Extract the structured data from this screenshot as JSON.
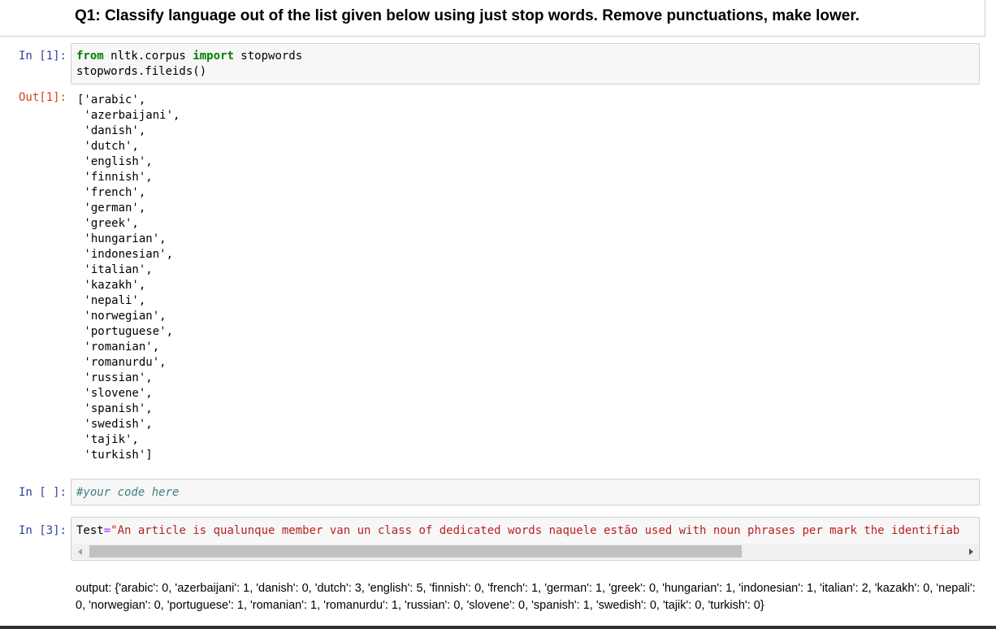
{
  "markdown": {
    "title": "Q1: Classify language out of the list given below using just stop words. Remove punctuations, make lower."
  },
  "cell1": {
    "in_prompt": "In [1]:",
    "line1": {
      "kw1": "from",
      "t1": " nltk.corpus ",
      "kw2": "import",
      "t2": " stopwords"
    },
    "line2": "stopwords.fileids()",
    "out_prompt": "Out[1]:",
    "output_items": [
      "arabic",
      "azerbaijani",
      "danish",
      "dutch",
      "english",
      "finnish",
      "french",
      "german",
      "greek",
      "hungarian",
      "indonesian",
      "italian",
      "kazakh",
      "nepali",
      "norwegian",
      "portuguese",
      "romanian",
      "romanurdu",
      "russian",
      "slovene",
      "spanish",
      "swedish",
      "tajik",
      "turkish"
    ]
  },
  "cell2": {
    "in_prompt": "In [ ]:",
    "code": "#your code here"
  },
  "cell3": {
    "in_prompt": "In [3]:",
    "var": "Test",
    "op": "=",
    "string": "\"An article is qualunque member van un class of dedicated words naquele estão used with noun phrases per mark the identifiab",
    "output": "output: {'arabic': 0, 'azerbaijani': 1, 'danish': 0, 'dutch': 3, 'english': 5, 'finnish': 0, 'french': 1, 'german': 1, 'greek': 0, 'hungarian': 1, 'indonesian': 1, 'italian': 2, 'kazakh': 0, 'nepali': 0, 'norwegian': 0, 'portuguese': 1, 'romanian': 1, 'romanurdu': 1, 'russian': 0, 'slovene': 0, 'spanish': 1, 'swedish': 0, 'tajik': 0, 'turkish': 0}"
  },
  "icons": {
    "scroll_left": "scroll-left-arrow-icon",
    "scroll_right": "scroll-right-arrow-icon"
  },
  "colors": {
    "prompt_in": "#303f9f",
    "prompt_out": "#d84315",
    "keyword": "#008000",
    "comment": "#408080",
    "string": "#ba2121"
  }
}
